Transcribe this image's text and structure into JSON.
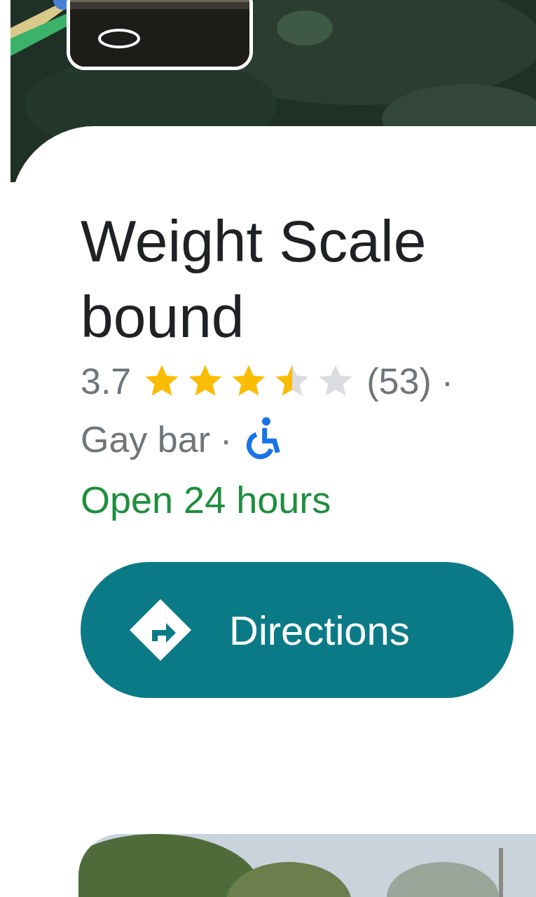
{
  "place": {
    "title_lines": [
      "Weight Scale",
      "bound"
    ],
    "rating": "3.7",
    "stars": 3.5,
    "review_count": "(53)",
    "separator": "·",
    "category": "Gay bar",
    "category_separator": "·",
    "hours": "Open 24 hours"
  },
  "directions_button": {
    "label": "Directions"
  }
}
